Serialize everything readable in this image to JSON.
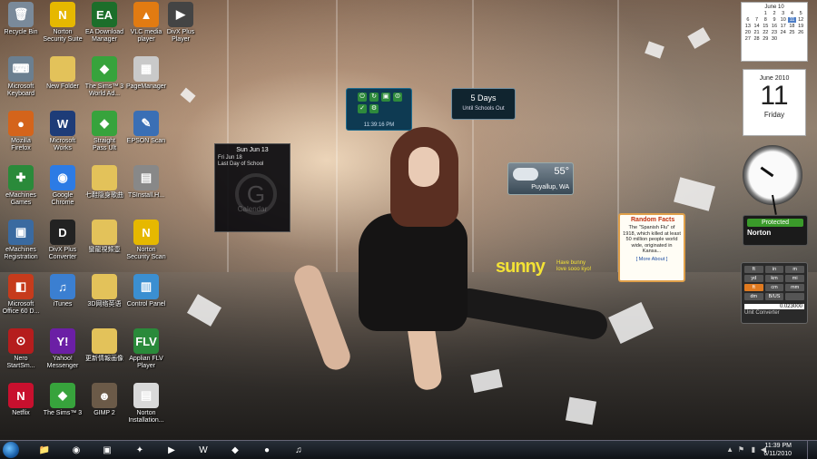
{
  "desktop_icons": [
    {
      "name": "recycle-bin-icon",
      "label": "Recycle Bin",
      "glyph": "🗑",
      "color": "#7a8a9a"
    },
    {
      "name": "norton-security-suite-icon",
      "label": "Norton\nSecurity Suite",
      "glyph": "N",
      "color": "#e6b800"
    },
    {
      "name": "ea-download-manager-icon",
      "label": "EA Download\nManager",
      "glyph": "EA",
      "color": "#1c6e2a"
    },
    {
      "name": "vlc-media-player-icon",
      "label": "VLC media\nplayer",
      "glyph": "▲",
      "color": "#e27b12"
    },
    {
      "name": "dvd-flick-player-icon",
      "label": "DivX Plus\nPlayer",
      "glyph": "▶",
      "color": "#444"
    },
    {
      "name": "my-computer-icon",
      "label": "Microsoft\nKeyboard",
      "glyph": "⌨",
      "color": "#6b7f90"
    },
    {
      "name": "new-folder-icon",
      "label": "New Folder",
      "glyph": "",
      "color": "#e3c25a"
    },
    {
      "name": "sims-world-icon",
      "label": "The Sims™ 3\nWorld Ad...",
      "glyph": "◆",
      "color": "#37a33c"
    },
    {
      "name": "pagemanager-icon",
      "label": "PageManager",
      "glyph": "▦",
      "color": "#c9c9c9"
    },
    {
      "name": "firefox-icon",
      "label": "Mozilla\nFirefox",
      "glyph": "●",
      "color": "#d4641b"
    },
    {
      "name": "microsoft-works-icon",
      "label": "Microsoft\nWorks",
      "glyph": "W",
      "color": "#1e3c78"
    },
    {
      "name": "sims-straight-icon",
      "label": "Straight\nPass Ult",
      "glyph": "◆",
      "color": "#37a33c"
    },
    {
      "name": "epson-scan-icon",
      "label": "EPSON Scan",
      "glyph": "✎",
      "color": "#3a6fb5"
    },
    {
      "name": "emachines-games-icon",
      "label": "eMachines\nGames",
      "glyph": "✚",
      "color": "#2a8a3a"
    },
    {
      "name": "google-chrome-icon",
      "label": "Google\nChrome",
      "glyph": "◉",
      "color": "#2c7be5"
    },
    {
      "name": "folder-cjk-1-icon",
      "label": "七鞋隐身歌曲",
      "glyph": "",
      "color": "#e3c25a"
    },
    {
      "name": "install-icon",
      "label": "TSInstall.H...",
      "glyph": "▤",
      "color": "#888"
    },
    {
      "name": "emachines-registration-icon",
      "label": "eMachines\nRegistration",
      "glyph": "▣",
      "color": "#3a6aa0"
    },
    {
      "name": "divx-converter-icon",
      "label": "DivX Plus\nConverter",
      "glyph": "D",
      "color": "#222"
    },
    {
      "name": "folder-cjk-2-icon",
      "label": "蠻龍視頻壺",
      "glyph": "",
      "color": "#e3c25a"
    },
    {
      "name": "norton-security-scan-icon",
      "label": "Norton\nSecurity Scan",
      "glyph": "N",
      "color": "#e6b800"
    },
    {
      "name": "microsoft-office-icon",
      "label": "Microsoft\nOffice 60 D...",
      "glyph": "◧",
      "color": "#c63b1c"
    },
    {
      "name": "itunes-icon",
      "label": "iTunes",
      "glyph": "♫",
      "color": "#3b7fd1"
    },
    {
      "name": "folder-cjk-3-icon",
      "label": "3D网络英语",
      "glyph": "",
      "color": "#e3c25a"
    },
    {
      "name": "control-panel-icon",
      "label": "Control Panel",
      "glyph": "▥",
      "color": "#3b8fd1"
    },
    {
      "name": "nero-startsmart-icon",
      "label": "Nero\nStartSm...",
      "glyph": "⊙",
      "color": "#b51d1d"
    },
    {
      "name": "yahoo-messenger-icon",
      "label": "Yahoo!\nMessenger",
      "glyph": "Y!",
      "color": "#6b1fa5"
    },
    {
      "name": "folder-cjk-4-icon",
      "label": "更新情報画像",
      "glyph": "",
      "color": "#e3c25a"
    },
    {
      "name": "applian-flv-player-icon",
      "label": "Applian FLV\nPlayer",
      "glyph": "FLV",
      "color": "#2a8a3a"
    },
    {
      "name": "netflix-icon",
      "label": "Netflix",
      "glyph": "N",
      "color": "#c8102e"
    },
    {
      "name": "sims3-icon",
      "label": "The Sims™ 3",
      "glyph": "◆",
      "color": "#37a33c"
    },
    {
      "name": "gimp-icon",
      "label": "GIMP 2",
      "glyph": "☻",
      "color": "#6b5a48"
    },
    {
      "name": "norton-installation-icon",
      "label": "Norton\nInstallation...",
      "glyph": "▤",
      "color": "#d9d9d9"
    }
  ],
  "calendar_gadget": {
    "header": "Sun Jun 13",
    "event_date": "Fri Jun 18",
    "event_title": "Last Day of School",
    "logo_letter": "G",
    "footer": "Calendar"
  },
  "control_gadget": {
    "time": "11:39:16 PM"
  },
  "countdown_gadget": {
    "days": "5 Days",
    "caption": "Until Schools Out"
  },
  "weather_gadget": {
    "temp": "55°",
    "location": "Puyallup, WA"
  },
  "facts_gadget": {
    "title": "Random Facts",
    "text": "The \"Spanish Flu\" of 1918, which killed at least 50 million people world wide, originated in Kansa...",
    "more": "[ More About ]"
  },
  "wallpaper_text": {
    "brand": "sunny",
    "tagline": "Have bunny\nlove sooo kyo!"
  },
  "month_gadget": {
    "header": "June 10",
    "days": [
      "",
      "",
      "1",
      "2",
      "3",
      "4",
      "5",
      "6",
      "7",
      "8",
      "9",
      "10",
      "11",
      "12",
      "13",
      "14",
      "15",
      "16",
      "17",
      "18",
      "19",
      "20",
      "21",
      "22",
      "23",
      "24",
      "25",
      "26",
      "27",
      "28",
      "29",
      "30",
      "",
      "",
      ""
    ],
    "selected": "11"
  },
  "day_gadget": {
    "month": "June 2010",
    "day": "11",
    "weekday": "Friday"
  },
  "norton_gadget": {
    "status": "Protected",
    "brand": "Norton"
  },
  "unit_gadget": {
    "cells": [
      "ft",
      "in",
      "m",
      "yd",
      "km",
      "mi",
      "ft",
      "cm",
      "mm",
      "dm",
      "B/US",
      ""
    ],
    "value": "0.023000",
    "title": "Unit Converter"
  },
  "taskbar": {
    "items": [
      {
        "name": "taskbar-explorer-button",
        "glyph": "📁"
      },
      {
        "name": "taskbar-chrome-button",
        "glyph": "◉"
      },
      {
        "name": "taskbar-network-button",
        "glyph": "▣"
      },
      {
        "name": "taskbar-game-button",
        "glyph": "✦"
      },
      {
        "name": "taskbar-media-player-button",
        "glyph": "▶"
      },
      {
        "name": "taskbar-word-button",
        "glyph": "W"
      },
      {
        "name": "taskbar-sims-button",
        "glyph": "◆"
      },
      {
        "name": "taskbar-firefox-button",
        "glyph": "●"
      },
      {
        "name": "taskbar-itunes-button",
        "glyph": "♫"
      }
    ],
    "time": "11:39 PM",
    "date": "6/11/2010"
  }
}
